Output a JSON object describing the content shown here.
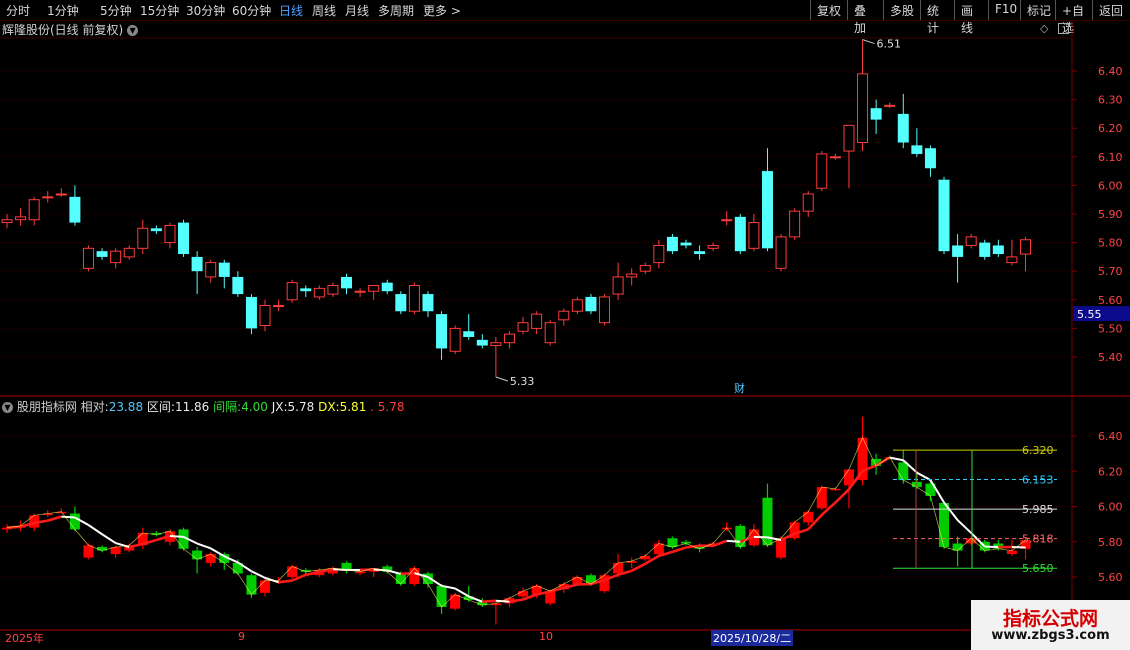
{
  "toolbar": {
    "periods": [
      "分时",
      "1分钟",
      "5分钟",
      "15分钟",
      "30分钟",
      "60分钟",
      "日线",
      "周线",
      "月线",
      "多周期",
      "更多 >"
    ],
    "active_period": "日线",
    "actions": [
      "复权",
      "叠加",
      "多股",
      "统计",
      "画线",
      "F10",
      "+自选",
      "返回"
    ]
  },
  "main_panel": {
    "stock_name": "辉隆股份(日线 前复权)",
    "price_axis": [
      "6.40",
      "6.30",
      "6.20",
      "6.10",
      "6.00",
      "5.90",
      "5.80",
      "5.70",
      "5.60",
      "5.50",
      "5.40"
    ],
    "current_price_tag": "5.55",
    "high_label": "6.51",
    "low_label": "5.33",
    "finance_marker": "财"
  },
  "indicator_panel": {
    "name": "股朋指标网",
    "relative_label": "相对:",
    "relative_value": "23.88",
    "range_label": "区间:",
    "range_value": "11.86",
    "interval_label": "间隔:",
    "interval_value": "4.00",
    "jx_label": "JX:",
    "jx_value": "5.78",
    "dx_label": "DX:",
    "dx_value": "5.81",
    "extra_value": "5.78",
    "price_axis": [
      "6.40",
      "6.20",
      "6.00",
      "5.80",
      "5.60"
    ],
    "levels": [
      "6.320",
      "6.153",
      "5.985",
      "5.818",
      "5.650"
    ]
  },
  "time_axis": {
    "labels": [
      "2025年",
      "9",
      "10"
    ],
    "cursor_date": "2025/10/28/二"
  },
  "watermark": {
    "text": "指标公式网",
    "url": "www.zbgs3.com"
  },
  "colors": {
    "up": "#ff3c3c",
    "down": "#54ffff",
    "up_fill": "#ff0000",
    "down_fill": "#00cc00",
    "grid": "#7a0000",
    "active": "#4aa3ff"
  },
  "chart_data": {
    "type": "candlestick",
    "title": "辉隆股份(日线 前复权)",
    "ylim": [
      5.3,
      6.52
    ],
    "candles": [
      {
        "o": 5.87,
        "h": 5.9,
        "l": 5.85,
        "c": 5.88
      },
      {
        "o": 5.88,
        "h": 5.92,
        "l": 5.86,
        "c": 5.89
      },
      {
        "o": 5.88,
        "h": 5.96,
        "l": 5.86,
        "c": 5.95
      },
      {
        "o": 5.96,
        "h": 5.98,
        "l": 5.94,
        "c": 5.96
      },
      {
        "o": 5.97,
        "h": 5.99,
        "l": 5.96,
        "c": 5.97
      },
      {
        "o": 5.96,
        "h": 6.0,
        "l": 5.86,
        "c": 5.87
      },
      {
        "o": 5.71,
        "h": 5.79,
        "l": 5.7,
        "c": 5.78
      },
      {
        "o": 5.77,
        "h": 5.78,
        "l": 5.74,
        "c": 5.75
      },
      {
        "o": 5.73,
        "h": 5.78,
        "l": 5.71,
        "c": 5.77
      },
      {
        "o": 5.75,
        "h": 5.79,
        "l": 5.74,
        "c": 5.78
      },
      {
        "o": 5.78,
        "h": 5.88,
        "l": 5.76,
        "c": 5.85
      },
      {
        "o": 5.85,
        "h": 5.86,
        "l": 5.83,
        "c": 5.84
      },
      {
        "o": 5.8,
        "h": 5.87,
        "l": 5.78,
        "c": 5.86
      },
      {
        "o": 5.87,
        "h": 5.88,
        "l": 5.75,
        "c": 5.76
      },
      {
        "o": 5.75,
        "h": 5.77,
        "l": 5.62,
        "c": 5.7
      },
      {
        "o": 5.68,
        "h": 5.74,
        "l": 5.66,
        "c": 5.73
      },
      {
        "o": 5.73,
        "h": 5.74,
        "l": 5.64,
        "c": 5.68
      },
      {
        "o": 5.68,
        "h": 5.7,
        "l": 5.61,
        "c": 5.62
      },
      {
        "o": 5.61,
        "h": 5.62,
        "l": 5.48,
        "c": 5.5
      },
      {
        "o": 5.51,
        "h": 5.6,
        "l": 5.49,
        "c": 5.58
      },
      {
        "o": 5.58,
        "h": 5.6,
        "l": 5.56,
        "c": 5.58
      },
      {
        "o": 5.6,
        "h": 5.67,
        "l": 5.59,
        "c": 5.66
      },
      {
        "o": 5.64,
        "h": 5.65,
        "l": 5.61,
        "c": 5.63
      },
      {
        "o": 5.61,
        "h": 5.65,
        "l": 5.6,
        "c": 5.64
      },
      {
        "o": 5.62,
        "h": 5.66,
        "l": 5.61,
        "c": 5.65
      },
      {
        "o": 5.68,
        "h": 5.69,
        "l": 5.62,
        "c": 5.64
      },
      {
        "o": 5.63,
        "h": 5.64,
        "l": 5.61,
        "c": 5.63
      },
      {
        "o": 5.63,
        "h": 5.65,
        "l": 5.6,
        "c": 5.65
      },
      {
        "o": 5.66,
        "h": 5.67,
        "l": 5.62,
        "c": 5.63
      },
      {
        "o": 5.62,
        "h": 5.63,
        "l": 5.55,
        "c": 5.56
      },
      {
        "o": 5.56,
        "h": 5.66,
        "l": 5.55,
        "c": 5.65
      },
      {
        "o": 5.62,
        "h": 5.63,
        "l": 5.54,
        "c": 5.56
      },
      {
        "o": 5.55,
        "h": 5.56,
        "l": 5.39,
        "c": 5.43
      },
      {
        "o": 5.42,
        "h": 5.51,
        "l": 5.41,
        "c": 5.5
      },
      {
        "o": 5.49,
        "h": 5.55,
        "l": 5.46,
        "c": 5.47
      },
      {
        "o": 5.46,
        "h": 5.48,
        "l": 5.43,
        "c": 5.44
      },
      {
        "o": 5.44,
        "h": 5.47,
        "l": 5.33,
        "c": 5.45
      },
      {
        "o": 5.45,
        "h": 5.49,
        "l": 5.43,
        "c": 5.48
      },
      {
        "o": 5.49,
        "h": 5.54,
        "l": 5.48,
        "c": 5.52
      },
      {
        "o": 5.5,
        "h": 5.56,
        "l": 5.48,
        "c": 5.55
      },
      {
        "o": 5.45,
        "h": 5.53,
        "l": 5.44,
        "c": 5.52
      },
      {
        "o": 5.53,
        "h": 5.57,
        "l": 5.51,
        "c": 5.56
      },
      {
        "o": 5.56,
        "h": 5.61,
        "l": 5.55,
        "c": 5.6
      },
      {
        "o": 5.61,
        "h": 5.62,
        "l": 5.55,
        "c": 5.56
      },
      {
        "o": 5.52,
        "h": 5.62,
        "l": 5.51,
        "c": 5.61
      },
      {
        "o": 5.62,
        "h": 5.73,
        "l": 5.6,
        "c": 5.68
      },
      {
        "o": 5.68,
        "h": 5.71,
        "l": 5.65,
        "c": 5.69
      },
      {
        "o": 5.7,
        "h": 5.73,
        "l": 5.69,
        "c": 5.72
      },
      {
        "o": 5.73,
        "h": 5.81,
        "l": 5.71,
        "c": 5.79
      },
      {
        "o": 5.82,
        "h": 5.83,
        "l": 5.76,
        "c": 5.77
      },
      {
        "o": 5.8,
        "h": 5.81,
        "l": 5.78,
        "c": 5.79
      },
      {
        "o": 5.77,
        "h": 5.79,
        "l": 5.74,
        "c": 5.76
      },
      {
        "o": 5.78,
        "h": 5.8,
        "l": 5.77,
        "c": 5.79
      },
      {
        "o": 5.88,
        "h": 5.91,
        "l": 5.86,
        "c": 5.88
      },
      {
        "o": 5.89,
        "h": 5.9,
        "l": 5.76,
        "c": 5.77
      },
      {
        "o": 5.78,
        "h": 5.9,
        "l": 5.77,
        "c": 5.87
      },
      {
        "o": 6.05,
        "h": 6.13,
        "l": 5.77,
        "c": 5.78
      },
      {
        "o": 5.71,
        "h": 5.83,
        "l": 5.7,
        "c": 5.82
      },
      {
        "o": 5.82,
        "h": 5.92,
        "l": 5.81,
        "c": 5.91
      },
      {
        "o": 5.91,
        "h": 5.98,
        "l": 5.89,
        "c": 5.97
      },
      {
        "o": 5.99,
        "h": 6.12,
        "l": 5.98,
        "c": 6.11
      },
      {
        "o": 6.1,
        "h": 6.11,
        "l": 6.09,
        "c": 6.1
      },
      {
        "o": 6.12,
        "h": 6.21,
        "l": 5.99,
        "c": 6.21
      },
      {
        "o": 6.15,
        "h": 6.51,
        "l": 6.12,
        "c": 6.39
      },
      {
        "o": 6.27,
        "h": 6.3,
        "l": 6.18,
        "c": 6.23
      },
      {
        "o": 6.28,
        "h": 6.29,
        "l": 6.27,
        "c": 6.28
      },
      {
        "o": 6.25,
        "h": 6.32,
        "l": 6.13,
        "c": 6.15
      },
      {
        "o": 6.14,
        "h": 6.2,
        "l": 6.1,
        "c": 6.11
      },
      {
        "o": 6.13,
        "h": 6.14,
        "l": 6.03,
        "c": 6.06
      },
      {
        "o": 6.02,
        "h": 6.03,
        "l": 5.76,
        "c": 5.77
      },
      {
        "o": 5.79,
        "h": 5.83,
        "l": 5.66,
        "c": 5.75
      },
      {
        "o": 5.79,
        "h": 5.83,
        "l": 5.78,
        "c": 5.82
      },
      {
        "o": 5.8,
        "h": 5.81,
        "l": 5.74,
        "c": 5.75
      },
      {
        "o": 5.79,
        "h": 5.81,
        "l": 5.75,
        "c": 5.76
      },
      {
        "o": 5.73,
        "h": 5.81,
        "l": 5.72,
        "c": 5.75
      },
      {
        "o": 5.76,
        "h": 5.82,
        "l": 5.7,
        "c": 5.81
      }
    ]
  }
}
